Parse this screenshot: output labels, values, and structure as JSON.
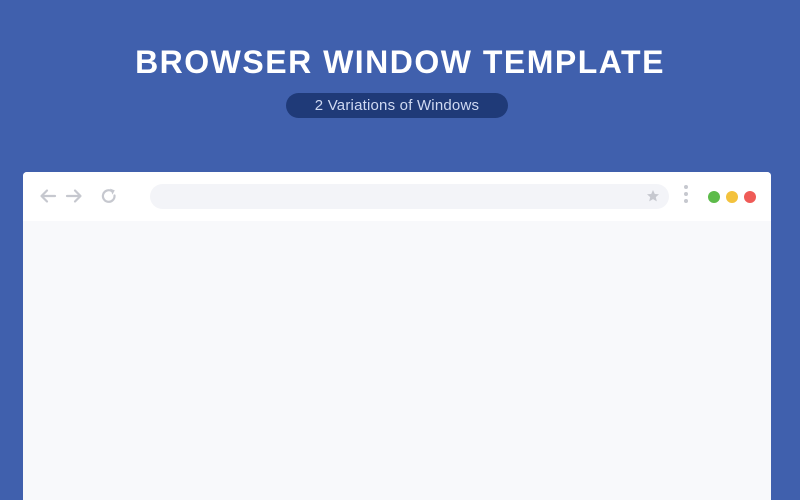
{
  "header": {
    "title": "BROWSER WINDOW TEMPLATE",
    "subtitle": "2 Variations of Windows"
  },
  "browser": {
    "address_bar": {
      "value": "",
      "placeholder": ""
    },
    "icons": {
      "back": "arrow-left-icon",
      "forward": "arrow-right-icon",
      "reload": "reload-icon",
      "bookmark": "star-icon",
      "menu": "kebab-menu-icon"
    },
    "window_controls": {
      "green": "#5dbb4a",
      "yellow": "#f3c23d",
      "red": "#ef5b57"
    }
  },
  "colors": {
    "background": "#4060ad",
    "pill": "#1f3a78",
    "content": "#f8f9fb",
    "icon": "#c6c8cf"
  }
}
